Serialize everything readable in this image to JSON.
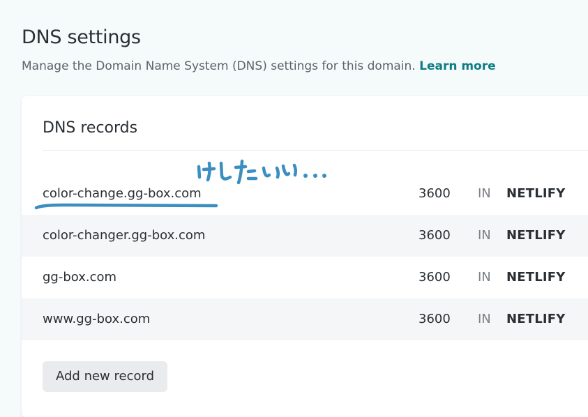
{
  "header": {
    "title": "DNS settings",
    "description": "Manage the Domain Name System (DNS) settings for this domain. ",
    "learn_more": "Learn more"
  },
  "card": {
    "title": "DNS records",
    "records": [
      {
        "name": "color-change.gg-box.com",
        "ttl": "3600",
        "class": "IN",
        "type": "NETLIFY"
      },
      {
        "name": "color-changer.gg-box.com",
        "ttl": "3600",
        "class": "IN",
        "type": "NETLIFY"
      },
      {
        "name": "gg-box.com",
        "ttl": "3600",
        "class": "IN",
        "type": "NETLIFY"
      },
      {
        "name": "www.gg-box.com",
        "ttl": "3600",
        "class": "IN",
        "type": "NETLIFY"
      }
    ],
    "add_button": "Add new record"
  },
  "annotation": {
    "text": "けしたい…",
    "color": "#3a8fc0"
  }
}
